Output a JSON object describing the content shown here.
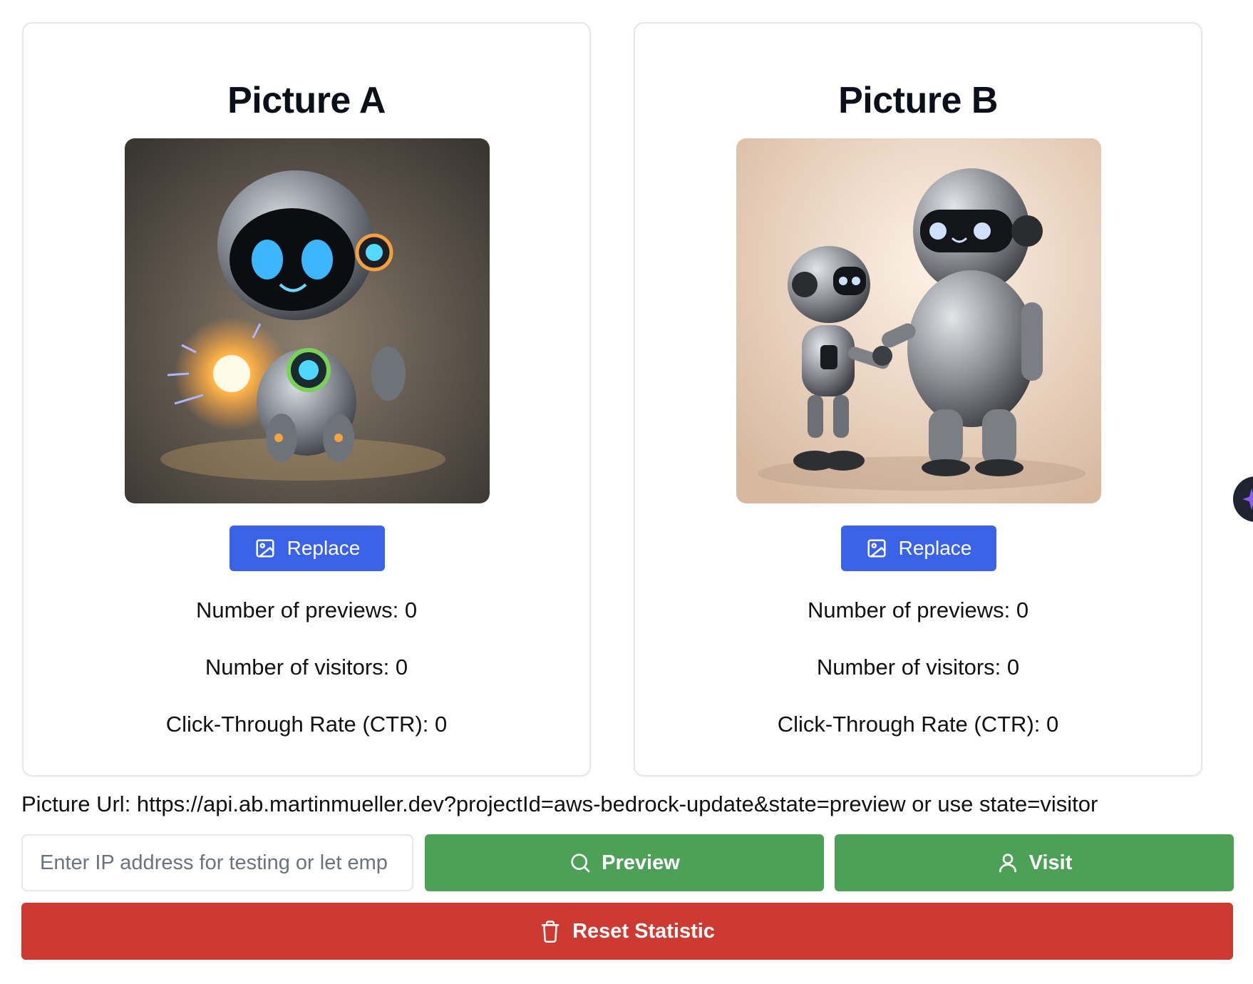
{
  "cards": [
    {
      "title": "Picture A",
      "image": "robot-with-energy-orb",
      "replace_label": "Replace",
      "previews_label": "Number of previews: 0",
      "visitors_label": "Number of visitors: 0",
      "ctr_label": "Click-Through Rate (CTR): 0"
    },
    {
      "title": "Picture B",
      "image": "two-robots-holding-hands",
      "replace_label": "Replace",
      "previews_label": "Number of previews: 0",
      "visitors_label": "Number of visitors: 0",
      "ctr_label": "Click-Through Rate (CTR): 0"
    }
  ],
  "url_line": "Picture Url: https://api.ab.martinmueller.dev?projectId=aws-bedrock-update&state=preview or use state=visitor",
  "ip_input": {
    "placeholder": "Enter IP address for testing or let emp",
    "value": ""
  },
  "actions": {
    "preview_label": "Preview",
    "visit_label": "Visit",
    "reset_label": "Reset Statistic"
  },
  "icons": {
    "replace": "image-icon",
    "preview": "search-icon",
    "visit": "user-icon",
    "reset": "trash-icon",
    "fab": "sparkle-icon"
  },
  "colors": {
    "primary": "#3b63e8",
    "success": "#4ca156",
    "danger": "#cc3a32",
    "border": "#e5e7eb"
  }
}
